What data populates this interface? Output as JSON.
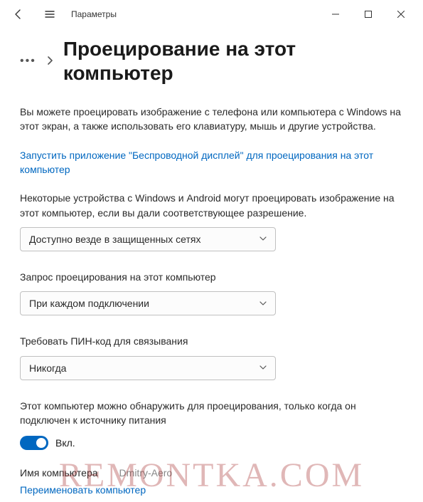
{
  "window": {
    "title": "Параметры"
  },
  "breadcrumb": {
    "page_title": "Проецирование на этот компьютер"
  },
  "intro": "Вы можете проецировать изображение с телефона или компьютера с Windows на этот экран, а также использовать его клавиатуру, мышь и другие устройства.",
  "launch_link": "Запустить приложение \"Беспроводной дисплей\" для проецирования на этот компьютер",
  "section1": {
    "label": "Некоторые устройства с Windows и Android могут проецировать изображение на этот компьютер, если вы дали соответствующее разрешение.",
    "value": "Доступно везде в защищенных сетях"
  },
  "section2": {
    "label": "Запрос проецирования на этот компьютер",
    "value": "При каждом подключении"
  },
  "section3": {
    "label": "Требовать ПИН-код для связывания",
    "value": "Никогда"
  },
  "discover": {
    "label": "Этот компьютер можно обнаружить для проецирования, только когда он подключен к источнику питания",
    "toggle_state": "Вкл."
  },
  "pcname": {
    "label": "Имя компьютера",
    "value": "Dmitry-Aero",
    "rename_link": "Переименовать компьютер"
  },
  "watermark": "REMONTKA.COM"
}
